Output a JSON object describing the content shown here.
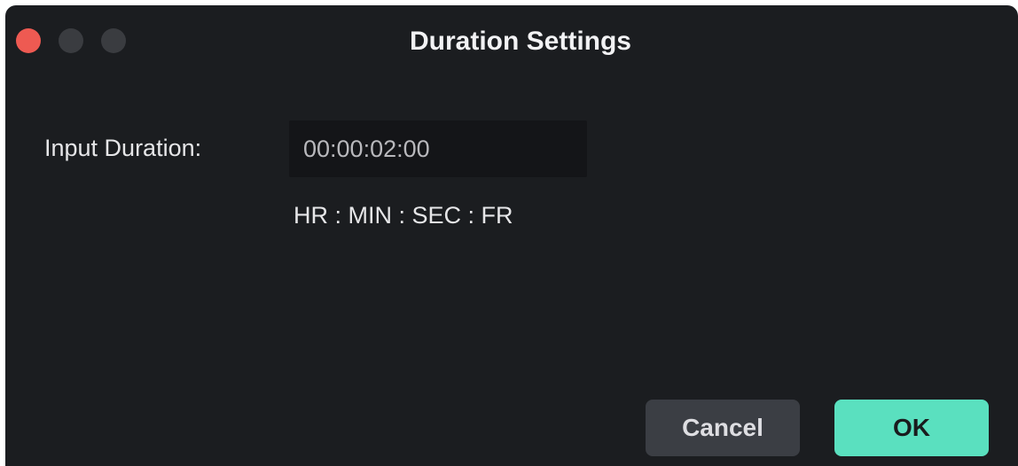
{
  "window": {
    "title": "Duration Settings"
  },
  "form": {
    "label": "Input Duration:",
    "value": "00:00:02:00",
    "format_hint": "HR : MIN : SEC : FR"
  },
  "buttons": {
    "cancel_label": "Cancel",
    "ok_label": "OK"
  },
  "colors": {
    "background": "#1b1d20",
    "close_button": "#ee5a52",
    "accent": "#5ae0bf",
    "cancel_button": "#3b3e44"
  }
}
